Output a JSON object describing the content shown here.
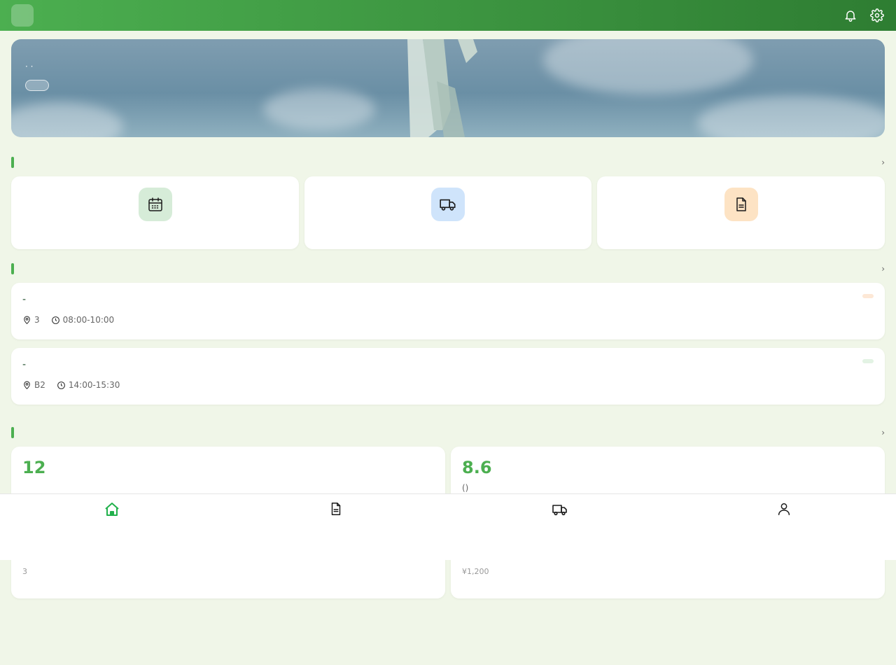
{
  "header": {
    "logo_glyph": "",
    "title": "",
    "icons": [
      "bell-icon",
      "gear-icon"
    ]
  },
  "banner": {
    "title": " ",
    "subtitle": " ·  · ",
    "button_label": ""
  },
  "services": {
    "title": "",
    "more_label": " ›",
    "items": [
      {
        "label": "",
        "icon": "calendar-icon",
        "bg": "#d6ecd8"
      },
      {
        "label": "",
        "icon": "truck-icon",
        "bg": "#cfe4fb"
      },
      {
        "label": "",
        "icon": "document-icon",
        "bg": "#fde3c4"
      }
    ]
  },
  "appointments": {
    "title": "",
    "more_label": " ›",
    "items": [
      {
        "title": " - ",
        "location": "3",
        "time": "08:00-10:00",
        "status": "",
        "status_bg": "#fde8d6",
        "status_color": "#d2691e"
      },
      {
        "title": " - ",
        "location": "B2",
        "time": "14:00-15:30",
        "status": "",
        "status_bg": "#e3f3e4",
        "status_color": "#2e7d32"
      }
    ]
  },
  "stats": {
    "title": "",
    "more_label": " ›",
    "items": [
      {
        "value": "12",
        "label": "",
        "foot_title": "",
        "foot_sub": "3"
      },
      {
        "value": "8.6",
        "label": " ()",
        "foot_title": "",
        "foot_sub": " ¥1,200"
      }
    ]
  },
  "tabbar": {
    "items": [
      {
        "label": "",
        "icon": "home-icon",
        "active": true
      },
      {
        "label": "",
        "icon": "document-icon",
        "active": false
      },
      {
        "label": "",
        "icon": "truck-icon",
        "active": false
      },
      {
        "label": "",
        "icon": "user-icon",
        "active": false
      }
    ]
  },
  "colors": {
    "accent": "#4caf50",
    "header_dark": "#2e7d32",
    "background": "#f0f6e8",
    "tab_active": "#22b14c"
  }
}
